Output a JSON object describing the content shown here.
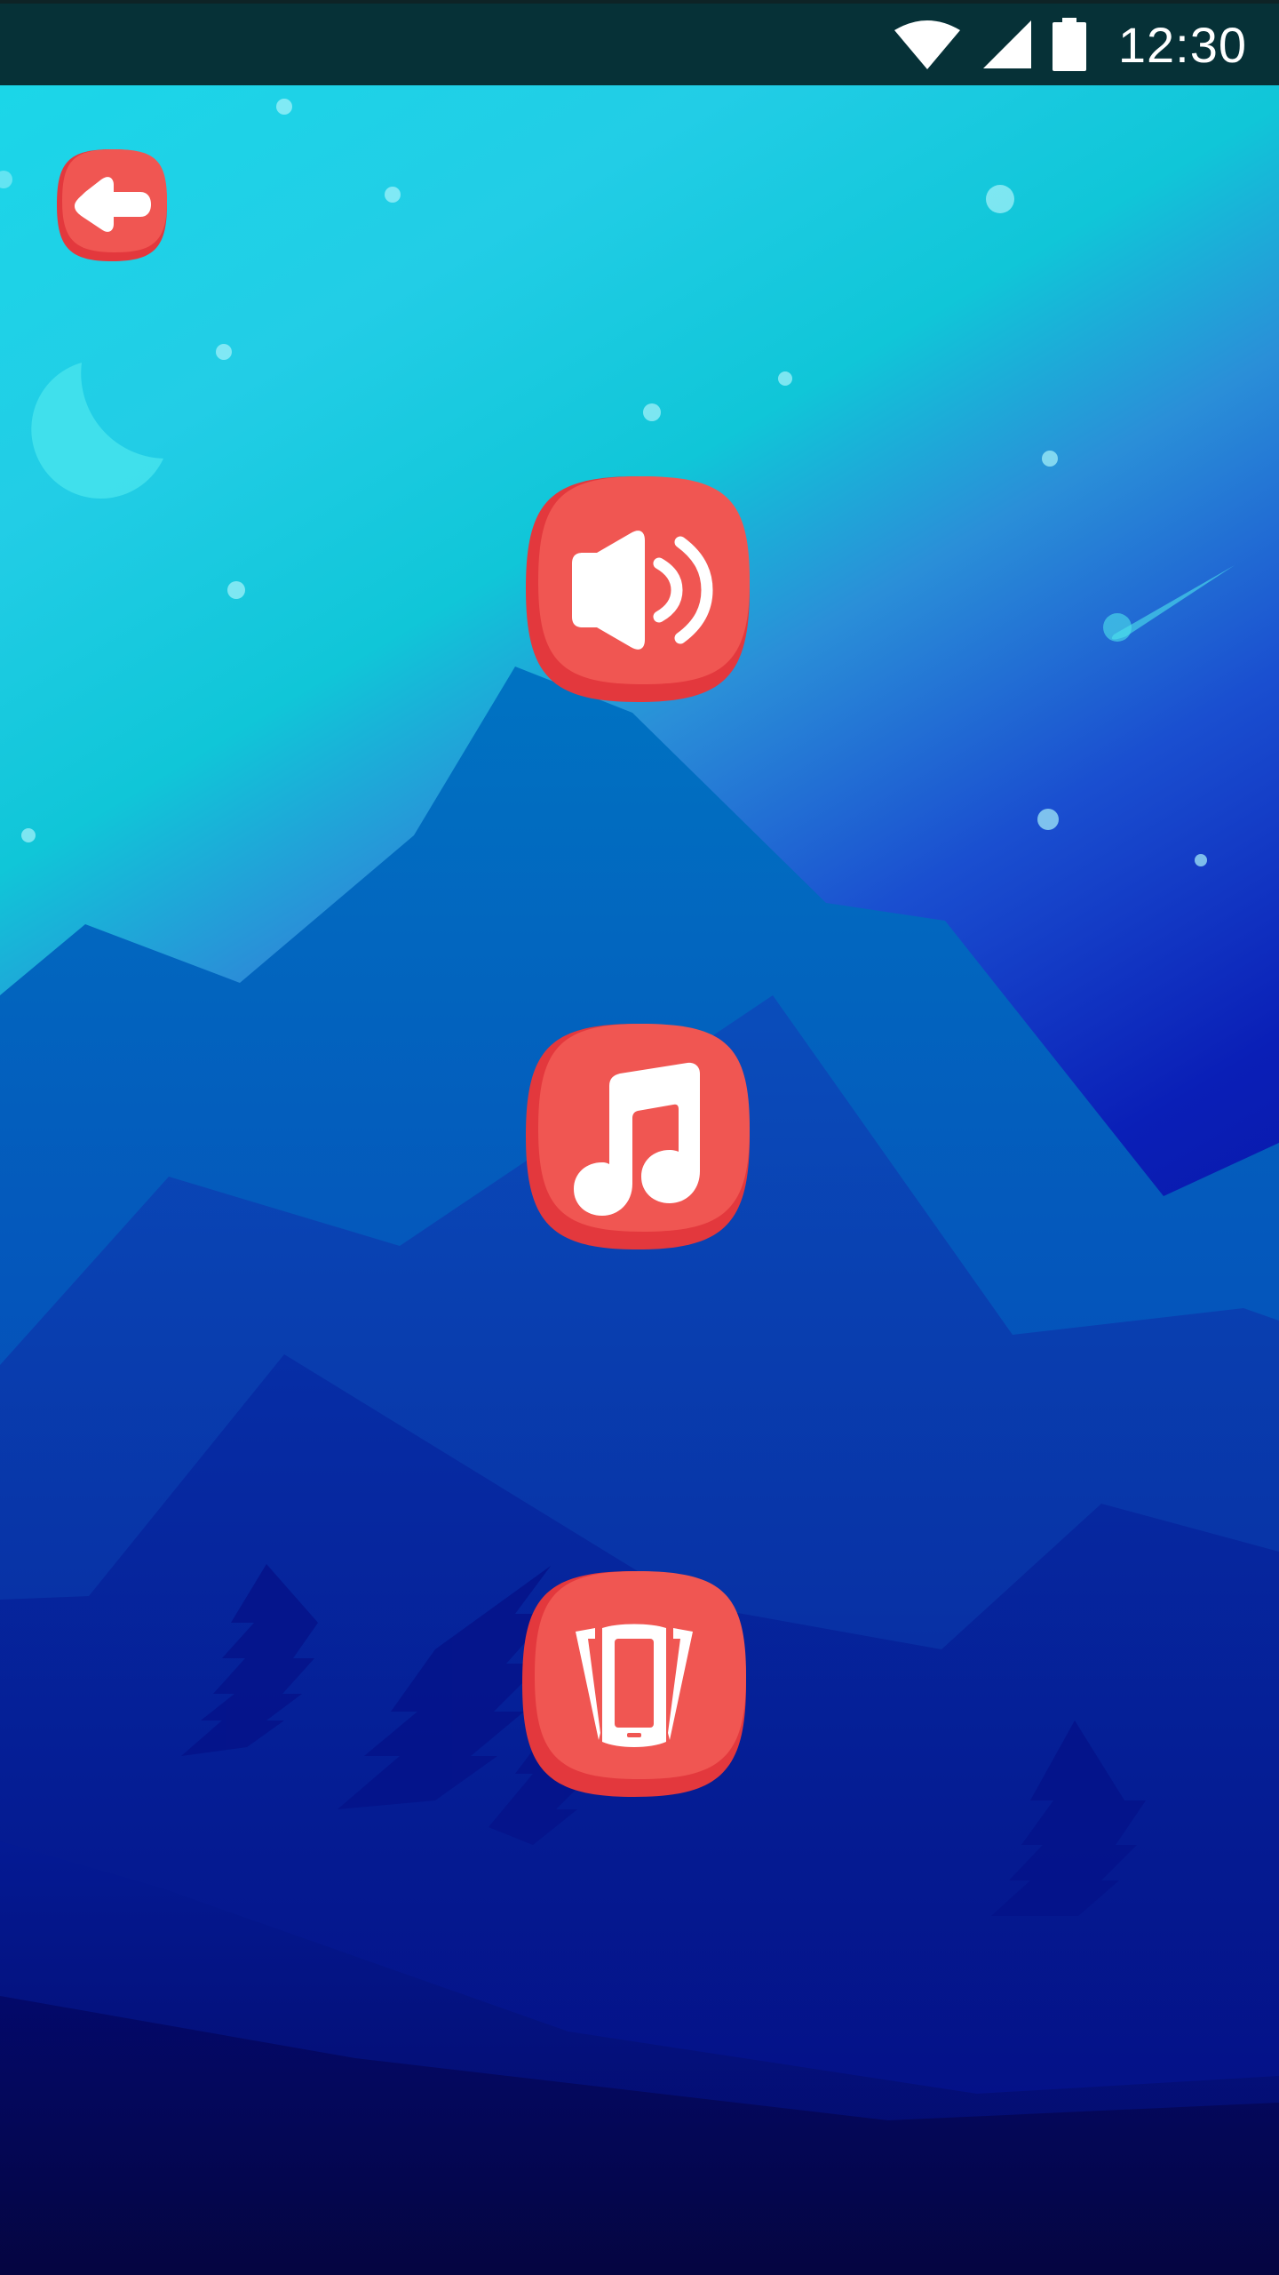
{
  "status_bar": {
    "time": "12:30",
    "icons": [
      "wifi-icon",
      "cellular-signal-icon",
      "battery-icon"
    ]
  },
  "buttons": {
    "back": {
      "icon": "arrow-left-icon"
    },
    "sound": {
      "icon": "speaker-icon"
    },
    "music": {
      "icon": "music-note-icon"
    },
    "vibration": {
      "icon": "vibrate-phone-icon"
    }
  },
  "colors": {
    "button_fill": "#f05652",
    "button_shade": "#e3383d",
    "status_bar": "#063137",
    "sky_top": "#1bd6e8",
    "sky_bottom": "#0a1fb7",
    "ground": "#050646"
  }
}
